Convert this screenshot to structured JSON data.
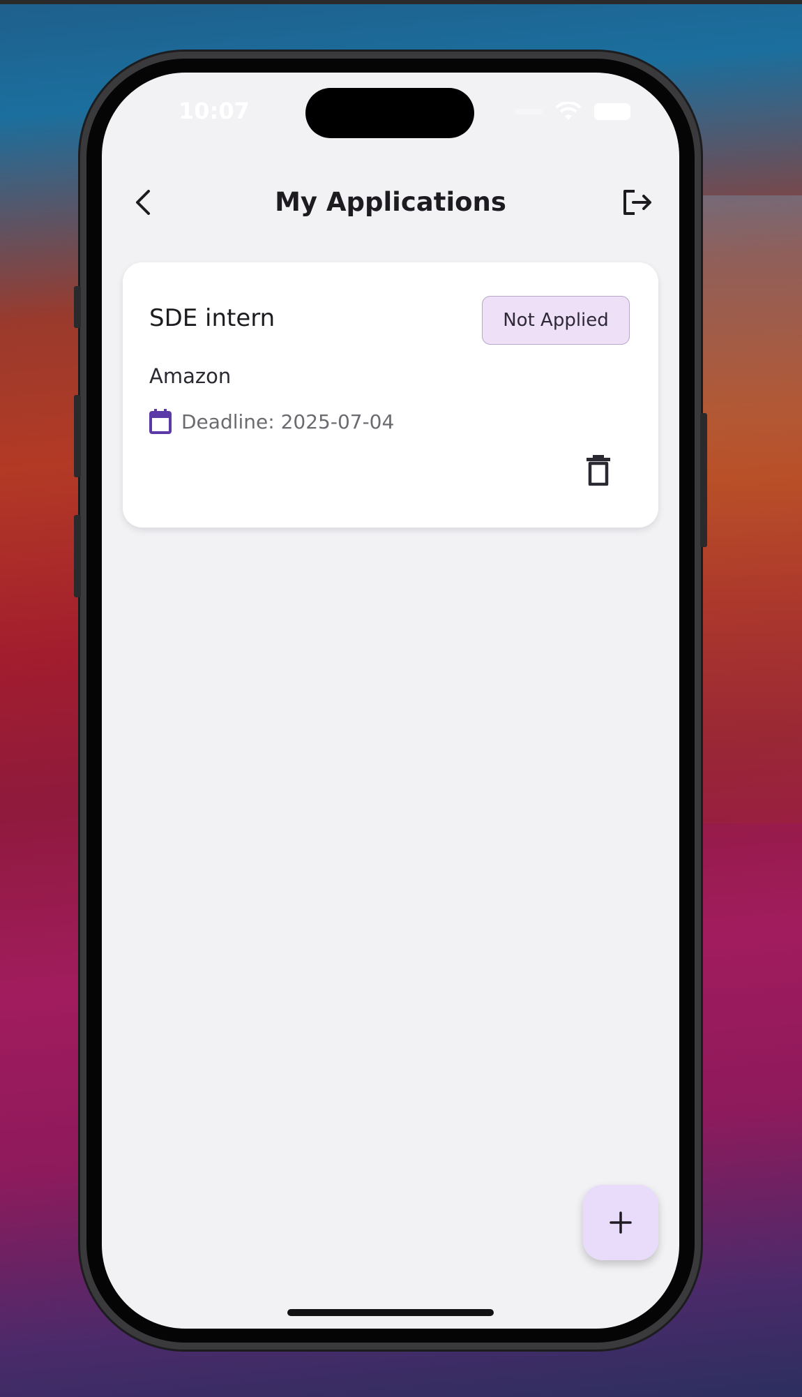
{
  "status_bar": {
    "time": "10:07"
  },
  "header": {
    "title": "My Applications"
  },
  "icons": {
    "back": "chevron-left-icon",
    "logout": "logout-icon",
    "calendar": "calendar-icon",
    "delete": "trash-icon",
    "add": "plus-icon"
  },
  "applications": [
    {
      "title": "SDE intern",
      "status": "Not Applied",
      "company": "Amazon",
      "deadline": "Deadline: 2025-07-04"
    }
  ],
  "colors": {
    "accent": "#5b3aa8",
    "badge_bg": "#ede0f7",
    "fab_bg": "#e9dcfb",
    "screen_bg": "#f2f2f5"
  }
}
